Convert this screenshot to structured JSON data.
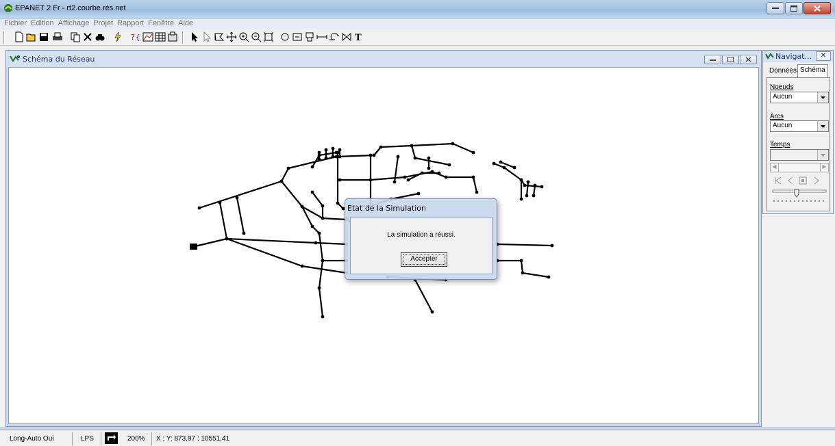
{
  "app": {
    "title": "EPANET 2 Fr - rt2.courbe.rés.net"
  },
  "menu": [
    "Fichier",
    "Edition",
    "Affichage",
    "Projet",
    "Rapport",
    "Fenêtre",
    "Aide"
  ],
  "toolbar_icons": [
    "new-icon",
    "open-icon",
    "save-icon",
    "print-icon",
    "copy-icon",
    "delete-icon",
    "find-icon",
    "run-icon",
    "query-icon",
    "graph-icon",
    "table-icon",
    "options-icon",
    "select-icon",
    "vertex-icon",
    "region-icon",
    "pan-icon",
    "zoom-in-icon",
    "zoom-out-icon",
    "full-extent-icon",
    "junction-icon",
    "reservoir-icon",
    "tank-icon",
    "pipe-icon",
    "pump-icon",
    "valve-icon",
    "label-icon"
  ],
  "map_window": {
    "title": "Schéma du Réseau"
  },
  "navigator": {
    "title": "Navigat...",
    "tabs": [
      "Données",
      "Schéma"
    ],
    "active_tab": "Schéma",
    "nodes_label": "Noeuds",
    "nodes_value": "Aucun",
    "links_label": "Arcs",
    "links_value": "Aucun",
    "time_label": "Temps",
    "time_value": ""
  },
  "dialog": {
    "title": "Etat de la Simulation",
    "message": "La simulation a réussi.",
    "button": "Accepter"
  },
  "statusbar": {
    "autolength": "Long-Auto Oui",
    "units": "LPS",
    "zoom": "200%",
    "coords": "X ; Y: 873,97 ; 10551,41"
  },
  "colors": {
    "accent": "#1e3b66",
    "network": "#000000"
  }
}
